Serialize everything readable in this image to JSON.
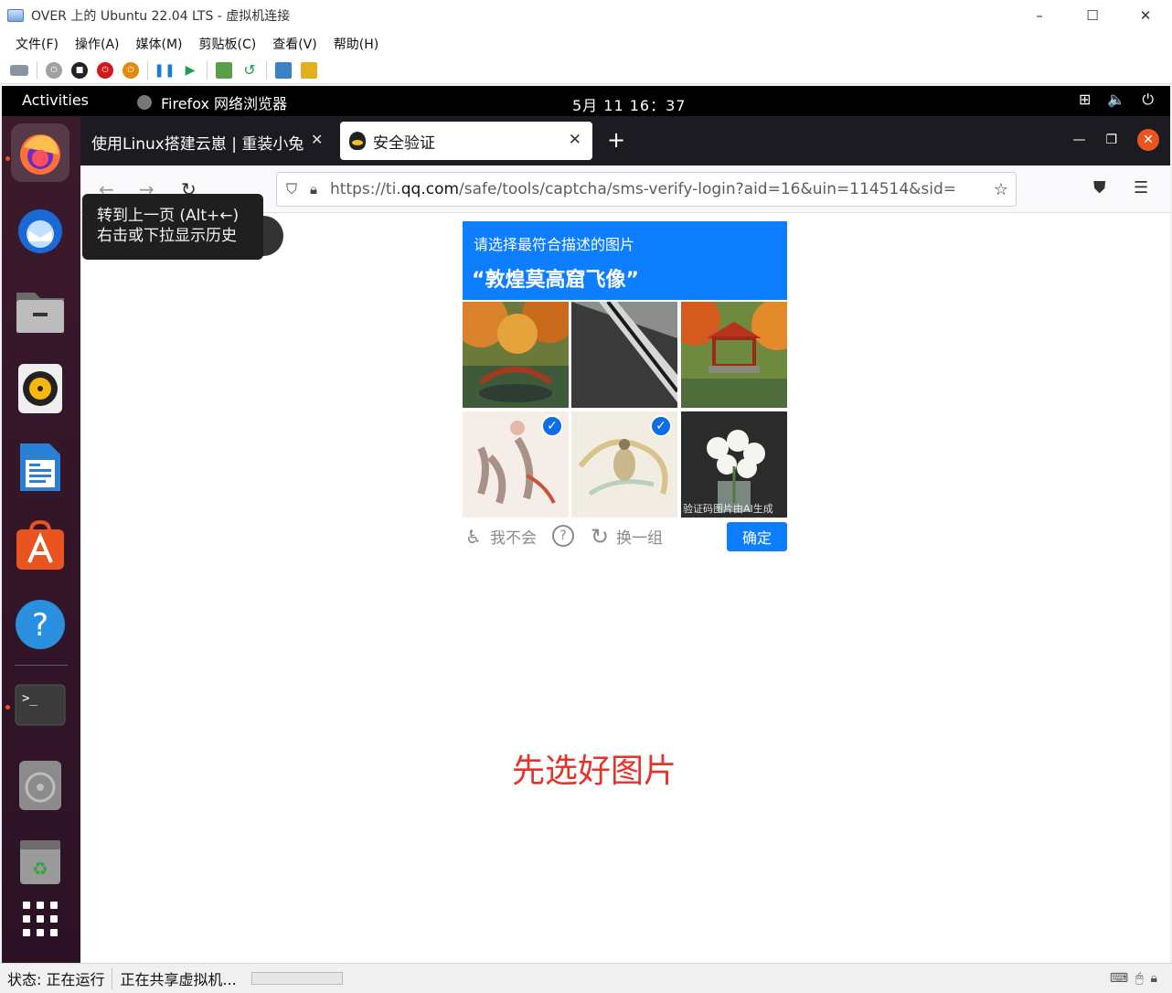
{
  "window": {
    "title": "OVER 上的 Ubuntu 22.04 LTS - 虚拟机连接",
    "minimize": "–",
    "maximize": "☐",
    "close": "✕"
  },
  "menu": [
    "文件(F)",
    "操作(A)",
    "媒体(M)",
    "剪贴板(C)",
    "查看(V)",
    "帮助(H)"
  ],
  "ubuntu": {
    "activities": "Activities",
    "app_name": "Firefox 网络浏览器",
    "clock": "5月 11  16：37"
  },
  "firefox": {
    "tab1_title": "使用Linux搭建云崽 | 重装小兔",
    "tab2_title": "安全验证",
    "url_prefix": "https://ti.",
    "url_domain": "qq.com",
    "url_path": "/safe/tools/captcha/sms-verify-login?aid=16&uin=114514&sid="
  },
  "tooltip": {
    "line1": "转到上一页 (Alt+←)",
    "line2": "右击或下拉显示历史"
  },
  "captcha": {
    "instruction": "请选择最符合描述的图片",
    "target": "“敦煌莫高窟飞像”",
    "watermark": "验证码图片由AI生成",
    "cant_label": "我不会",
    "help_label": "?",
    "refresh_label": "换一组",
    "confirm_label": "确定",
    "selected": [
      false,
      false,
      false,
      true,
      true,
      false
    ]
  },
  "annotation": "先选好图片",
  "statusbar": {
    "state": "状态: 正在运行",
    "sharing": "正在共享虚拟机..."
  }
}
